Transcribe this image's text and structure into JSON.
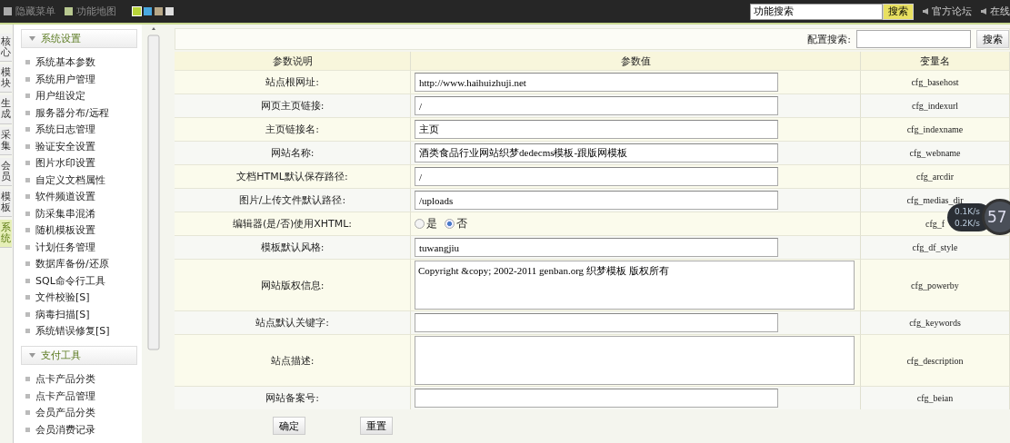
{
  "topbar": {
    "links": [
      "隐藏菜单",
      "功能地图"
    ],
    "skins": [
      {
        "color": "#b8d43a",
        "selected": true
      },
      {
        "color": "#4aa8e0",
        "selected": false
      },
      {
        "color": "#b8a888",
        "selected": false
      },
      {
        "color": "#dddddd",
        "selected": false
      }
    ],
    "search": {
      "value": "功能搜索",
      "button": "搜索"
    },
    "right_links": [
      "官方论坛",
      "在线"
    ]
  },
  "side_tabs": [
    {
      "label": "核心",
      "selected": false
    },
    {
      "label": "模块",
      "selected": false
    },
    {
      "label": "生成",
      "selected": false
    },
    {
      "label": "采集",
      "selected": false
    },
    {
      "label": "会员",
      "selected": false
    },
    {
      "label": "模板",
      "selected": false
    },
    {
      "label": "系统",
      "selected": true
    }
  ],
  "menu_groups": [
    {
      "title": "系统设置",
      "expanded": true,
      "items": [
        "系统基本参数",
        "系统用户管理",
        "用户组设定",
        "服务器分布/远程",
        "系统日志管理",
        "验证安全设置",
        "图片水印设置",
        "自定义文档属性",
        "软件频道设置",
        "防采集串混淆",
        "随机模板设置",
        "计划任务管理",
        "数据库备份/还原",
        "SQL命令行工具",
        "文件校验[S]",
        "病毒扫描[S]",
        "系统错误修复[S]"
      ]
    },
    {
      "title": "支付工具",
      "expanded": true,
      "items": [
        "点卡产品分类",
        "点卡产品管理",
        "会员产品分类",
        "会员消费记录"
      ]
    }
  ],
  "config_search": {
    "label": "配置搜索:",
    "button": "搜索"
  },
  "table": {
    "columns": [
      "参数说明",
      "参数值",
      "变量名"
    ],
    "rows": [
      {
        "kind": "text",
        "label": "站点根网址:",
        "value": "http://www.haihuizhuji.net",
        "var": "cfg_basehost"
      },
      {
        "kind": "text",
        "label": "网页主页链接:",
        "value": "/",
        "var": "cfg_indexurl"
      },
      {
        "kind": "text",
        "label": "主页链接名:",
        "value": "主页",
        "var": "cfg_indexname"
      },
      {
        "kind": "text",
        "label": "网站名称:",
        "value": "酒类食品行业网站织梦dedecms模板-跟版网模板",
        "var": "cfg_webname"
      },
      {
        "kind": "text",
        "label": "文档HTML默认保存路径:",
        "value": "/",
        "var": "cfg_arcdir"
      },
      {
        "kind": "text",
        "label": "图片/上传文件默认路径:",
        "value": "/uploads",
        "var": "cfg_medias_dir"
      },
      {
        "kind": "radio",
        "label": "编辑器(是/否)使用XHTML:",
        "options": [
          {
            "label": "是",
            "selected": false
          },
          {
            "label": "否",
            "selected": true
          }
        ],
        "var": "cfg_f"
      },
      {
        "kind": "text",
        "label": "模板默认风格:",
        "value": "tuwangjiu",
        "var": "cfg_df_style"
      },
      {
        "kind": "textarea",
        "label": "网站版权信息:",
        "value": "Copyright &copy; 2002-2011 genban.org 织梦模板 版权所有",
        "var": "cfg_powerby"
      },
      {
        "kind": "text",
        "label": "站点默认关键字:",
        "value": "",
        "var": "cfg_keywords"
      },
      {
        "kind": "textarea",
        "label": "站点描述:",
        "value": "",
        "var": "cfg_description"
      },
      {
        "kind": "text",
        "label": "网站备案号:",
        "value": "",
        "var": "cfg_beian"
      }
    ]
  },
  "buttons": [
    "确定",
    "重置"
  ],
  "speed_widget": {
    "up": "0.1K/s",
    "down": "0.2K/s",
    "reading": "57"
  }
}
